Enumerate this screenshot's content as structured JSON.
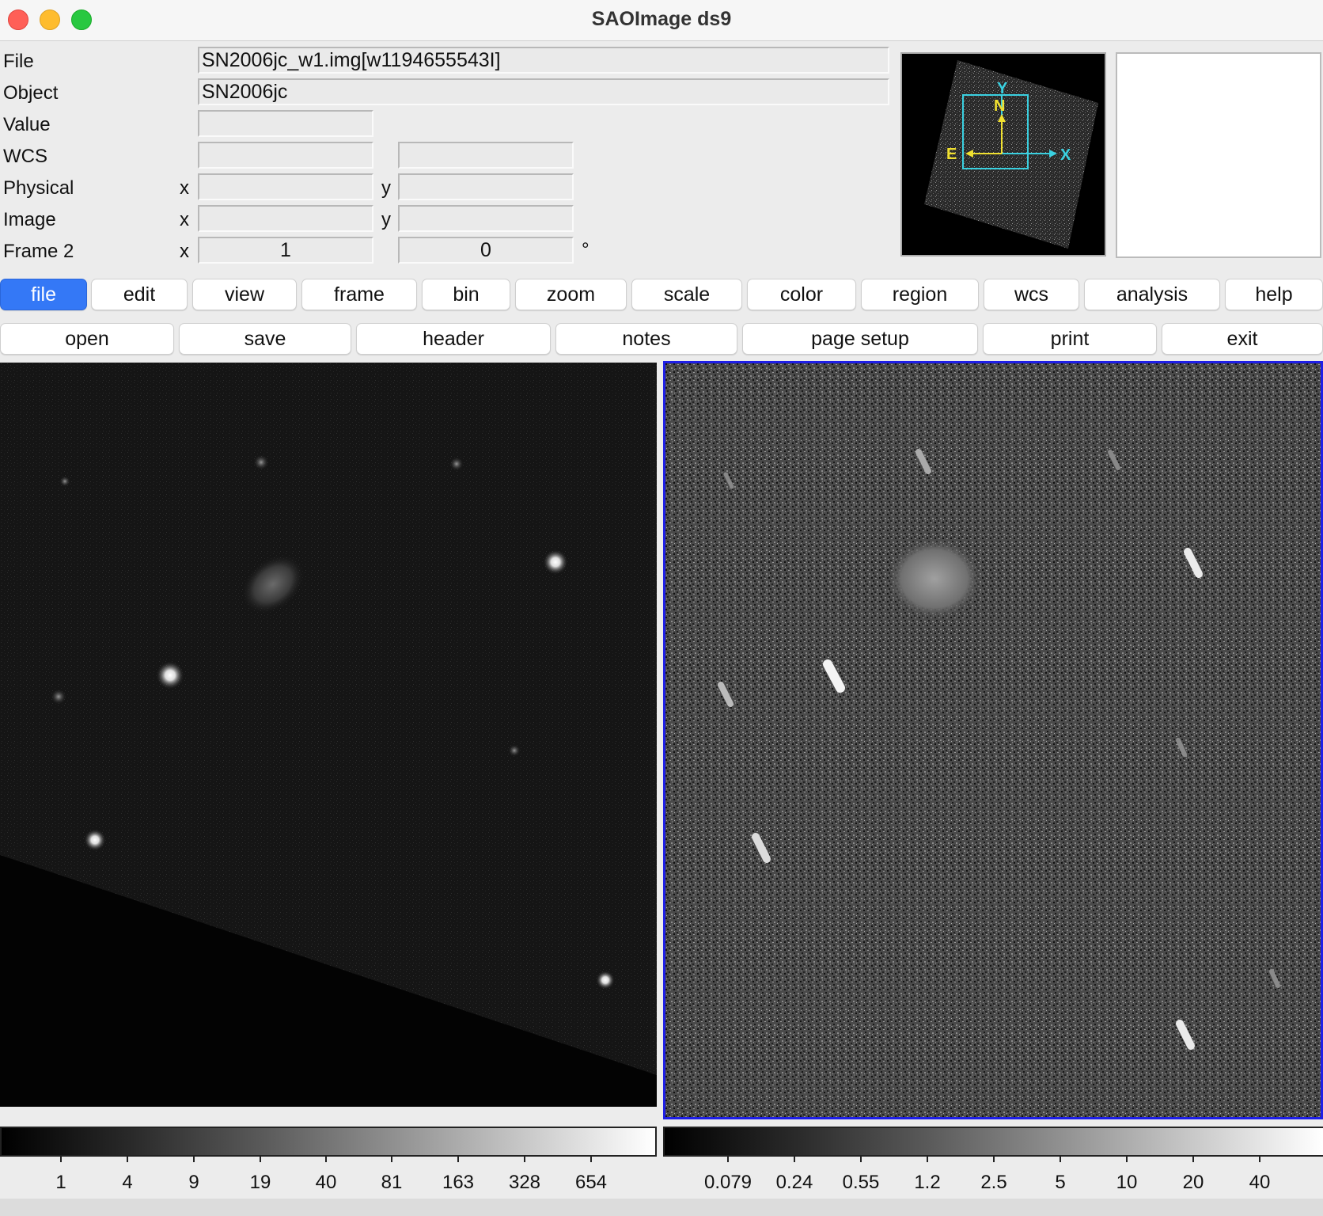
{
  "window": {
    "title": "SAOImage ds9"
  },
  "info": {
    "labels": {
      "file": "File",
      "object": "Object",
      "value": "Value",
      "wcs": "WCS",
      "physical": "Physical",
      "image": "Image",
      "frame": "Frame 2"
    },
    "axes": {
      "x": "x",
      "y": "y"
    },
    "file_value": "SN2006jc_w1.img[w1194655543I]",
    "object_value": "SN2006jc",
    "frame_x": "1",
    "frame_y": "0",
    "degree_symbol": "°"
  },
  "panner": {
    "labels": {
      "y": "Y",
      "n": "N",
      "e": "E",
      "x": "X"
    },
    "colors": {
      "image_box": "#3ad0e0",
      "compass": "#f0e030"
    }
  },
  "menubar": {
    "items": [
      "file",
      "edit",
      "view",
      "frame",
      "bin",
      "zoom",
      "scale",
      "color",
      "region",
      "wcs",
      "analysis",
      "help"
    ],
    "active": "file",
    "active_color": "#3478f6"
  },
  "buttonbar": {
    "items": [
      "open",
      "save",
      "header",
      "notes",
      "page setup",
      "print",
      "exit"
    ]
  },
  "frames": {
    "active_frame_border_color": "#1f1fe6"
  },
  "colorbar1": {
    "ticks": [
      "1",
      "4",
      "9",
      "19",
      "40",
      "81",
      "163",
      "328",
      "654"
    ]
  },
  "colorbar2": {
    "ticks": [
      "0.079",
      "0.24",
      "0.55",
      "1.2",
      "2.5",
      "5",
      "10",
      "20",
      "40"
    ]
  }
}
